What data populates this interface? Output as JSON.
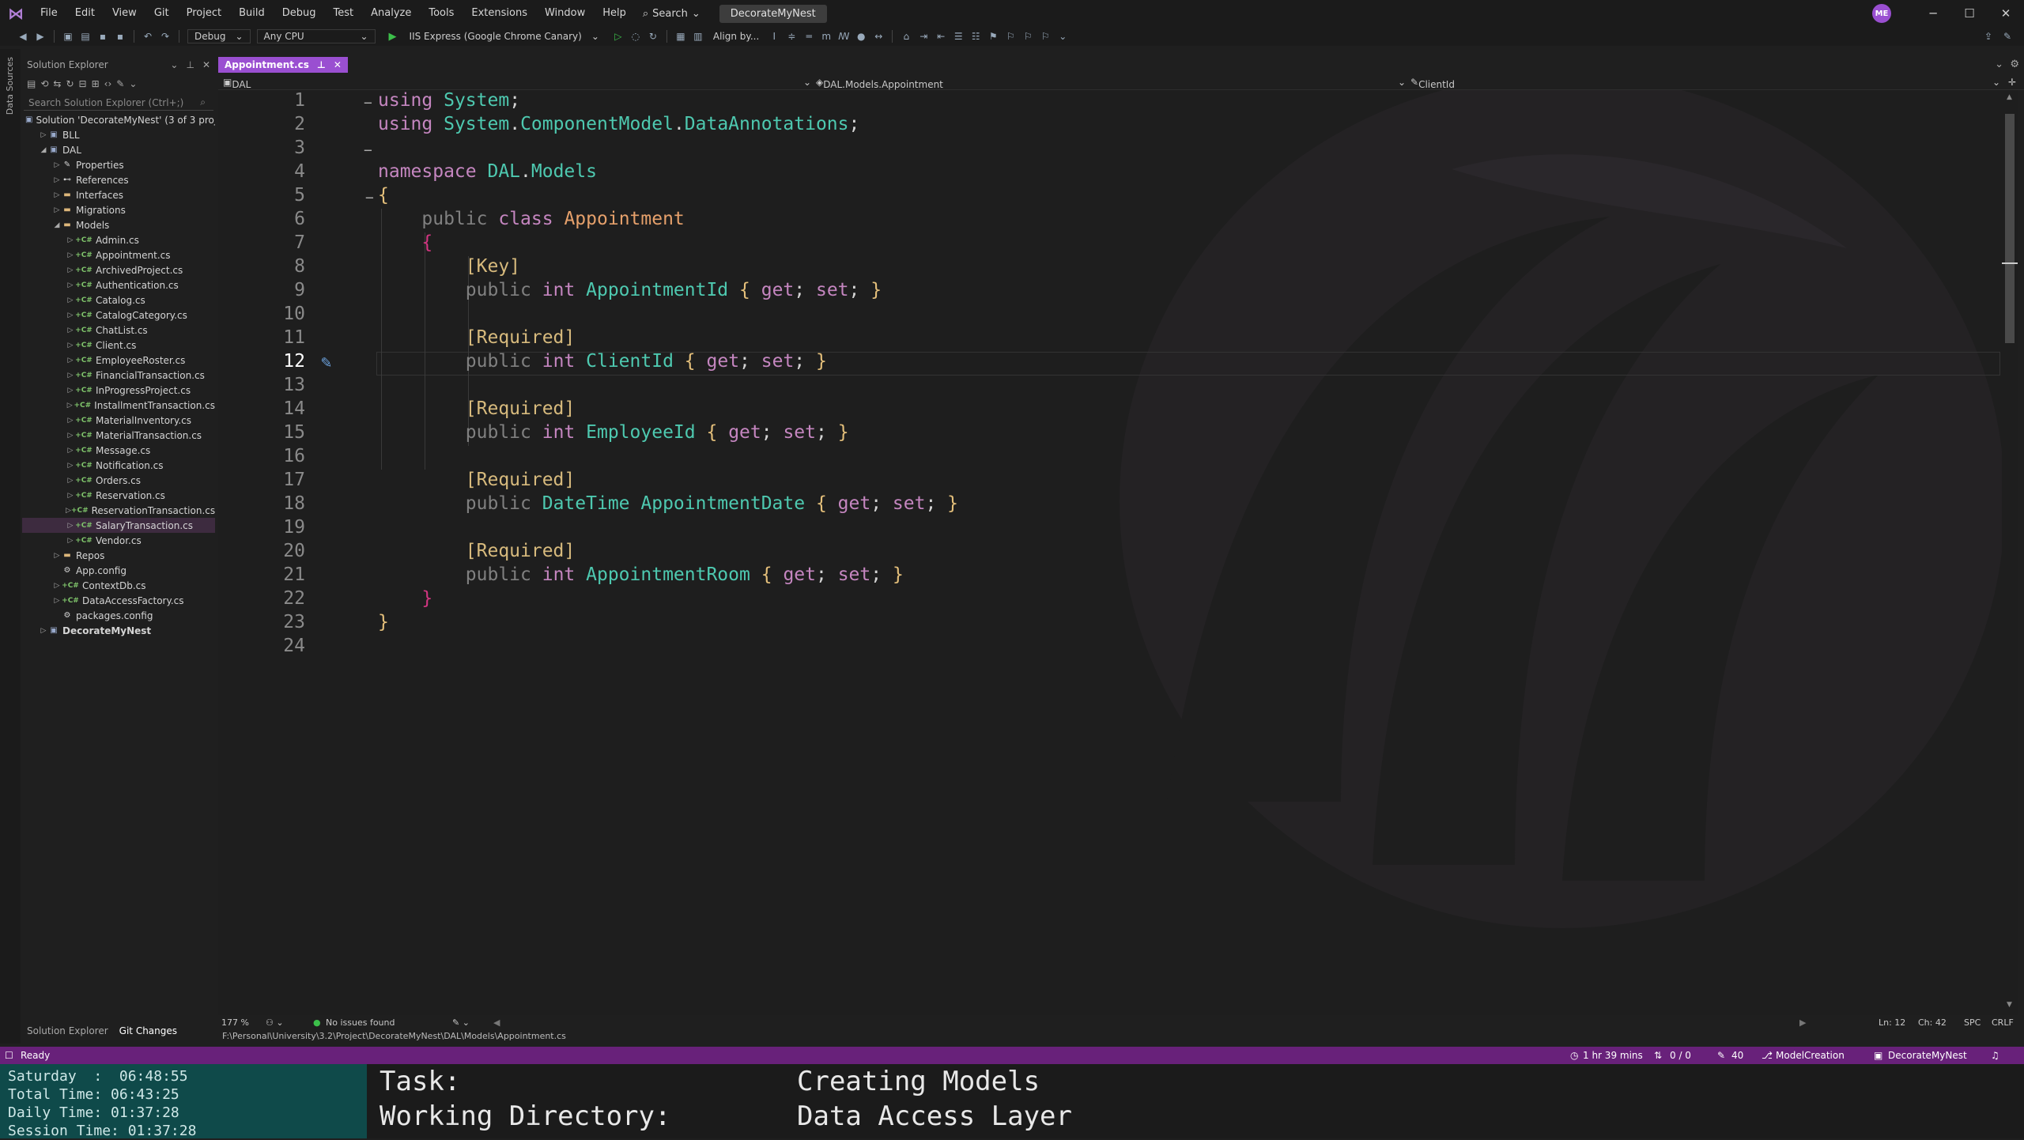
{
  "menubar": {
    "items": [
      "File",
      "Edit",
      "View",
      "Git",
      "Project",
      "Build",
      "Debug",
      "Test",
      "Analyze",
      "Tools",
      "Extensions",
      "Window",
      "Help"
    ],
    "search_label": "Search",
    "solution_name": "DecorateMyNest",
    "avatar_initials": "ME"
  },
  "toolbar": {
    "config": "Debug",
    "platform": "Any CPU",
    "run_target": "IIS Express (Google Chrome Canary)",
    "align_label": "Align by..."
  },
  "side_strip_label": "Data Sources",
  "solution_explorer": {
    "title": "Solution Explorer",
    "search_placeholder": "Search Solution Explorer (Ctrl+;)",
    "rows": [
      {
        "label": "Solution 'DecorateMyNest' (3 of 3 projects)",
        "indent": 0,
        "arrow": "",
        "icon": "solution"
      },
      {
        "label": "BLL",
        "indent": 1,
        "arrow": "▷",
        "icon": "project"
      },
      {
        "label": "DAL",
        "indent": 1,
        "arrow": "◢",
        "icon": "project"
      },
      {
        "label": "Properties",
        "indent": 2,
        "arrow": "▷",
        "icon": "wrench"
      },
      {
        "label": "References",
        "indent": 2,
        "arrow": "▷",
        "icon": "ref"
      },
      {
        "label": "Interfaces",
        "indent": 2,
        "arrow": "▷",
        "icon": "folder"
      },
      {
        "label": "Migrations",
        "indent": 2,
        "arrow": "▷",
        "icon": "folder"
      },
      {
        "label": "Models",
        "indent": 2,
        "arrow": "◢",
        "icon": "folder"
      },
      {
        "label": "Admin.cs",
        "indent": 3,
        "arrow": "▷",
        "icon": "cs"
      },
      {
        "label": "Appointment.cs",
        "indent": 3,
        "arrow": "▷",
        "icon": "cs"
      },
      {
        "label": "ArchivedProject.cs",
        "indent": 3,
        "arrow": "▷",
        "icon": "cs"
      },
      {
        "label": "Authentication.cs",
        "indent": 3,
        "arrow": "▷",
        "icon": "cs"
      },
      {
        "label": "Catalog.cs",
        "indent": 3,
        "arrow": "▷",
        "icon": "cs"
      },
      {
        "label": "CatalogCategory.cs",
        "indent": 3,
        "arrow": "▷",
        "icon": "cs"
      },
      {
        "label": "ChatList.cs",
        "indent": 3,
        "arrow": "▷",
        "icon": "cs"
      },
      {
        "label": "Client.cs",
        "indent": 3,
        "arrow": "▷",
        "icon": "cs"
      },
      {
        "label": "EmployeeRoster.cs",
        "indent": 3,
        "arrow": "▷",
        "icon": "cs"
      },
      {
        "label": "FinancialTransaction.cs",
        "indent": 3,
        "arrow": "▷",
        "icon": "cs"
      },
      {
        "label": "InProgressProject.cs",
        "indent": 3,
        "arrow": "▷",
        "icon": "cs"
      },
      {
        "label": "InstallmentTransaction.cs",
        "indent": 3,
        "arrow": "▷",
        "icon": "cs"
      },
      {
        "label": "MaterialInventory.cs",
        "indent": 3,
        "arrow": "▷",
        "icon": "cs"
      },
      {
        "label": "MaterialTransaction.cs",
        "indent": 3,
        "arrow": "▷",
        "icon": "cs"
      },
      {
        "label": "Message.cs",
        "indent": 3,
        "arrow": "▷",
        "icon": "cs"
      },
      {
        "label": "Notification.cs",
        "indent": 3,
        "arrow": "▷",
        "icon": "cs"
      },
      {
        "label": "Orders.cs",
        "indent": 3,
        "arrow": "▷",
        "icon": "cs"
      },
      {
        "label": "Reservation.cs",
        "indent": 3,
        "arrow": "▷",
        "icon": "cs"
      },
      {
        "label": "ReservationTransaction.cs",
        "indent": 3,
        "arrow": "▷",
        "icon": "cs"
      },
      {
        "label": "SalaryTransaction.cs",
        "indent": 3,
        "arrow": "▷",
        "icon": "cs",
        "selected": true
      },
      {
        "label": "Vendor.cs",
        "indent": 3,
        "arrow": "▷",
        "icon": "cs"
      },
      {
        "label": "Repos",
        "indent": 2,
        "arrow": "▷",
        "icon": "folder"
      },
      {
        "label": "App.config",
        "indent": 2,
        "arrow": "",
        "icon": "config"
      },
      {
        "label": "ContextDb.cs",
        "indent": 2,
        "arrow": "▷",
        "icon": "cs"
      },
      {
        "label": "DataAccessFactory.cs",
        "indent": 2,
        "arrow": "▷",
        "icon": "cs"
      },
      {
        "label": "packages.config",
        "indent": 2,
        "arrow": "",
        "icon": "config"
      },
      {
        "label": "DecorateMyNest",
        "indent": 1,
        "arrow": "▷",
        "icon": "project",
        "bold": true
      }
    ],
    "bottom_tabs": [
      "Solution Explorer",
      "Git Changes"
    ]
  },
  "editor": {
    "tab_label": "Appointment.cs",
    "nav_project": "DAL",
    "nav_class": "DAL.Models.Appointment",
    "nav_member": "ClientId",
    "current_line": 12
  },
  "status": {
    "zoom": "177 %",
    "issues": "No issues found",
    "ln": "Ln: 12",
    "ch": "Ch: 42",
    "spc": "SPC",
    "crlf": "CRLF",
    "path": "F:\\Personal\\University\\3.2\\Project\\DecorateMyNest\\DAL\\Models\\Appointment.cs",
    "ready": "Ready",
    "time": "1 hr 39 mins",
    "sync": "0 / 0",
    "edits": "40",
    "branch": "ModelCreation",
    "repo": "DecorateMyNest"
  },
  "overlay": {
    "lines": [
      "Saturday  :  06:48:55",
      "Total Time: 06:43:25",
      "Daily Time: 01:37:28",
      "Session Time: 01:37:28"
    ],
    "task_label": "Task:",
    "task_value": "Creating Models",
    "dir_label": "Working Directory:",
    "dir_value": "Data Access Layer"
  },
  "colors": {
    "accent": "#9a4fd1",
    "statusbar": "#68217a",
    "overlay_left": "#0f4a4a"
  }
}
